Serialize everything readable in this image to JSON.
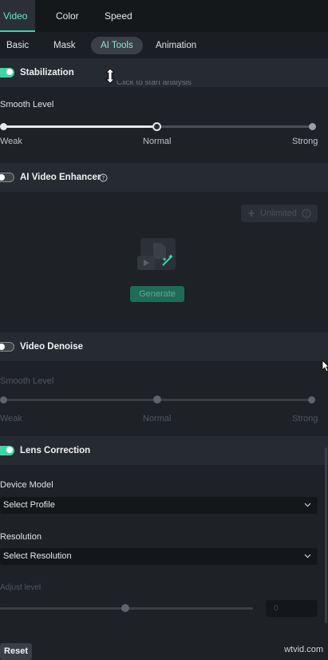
{
  "top_tabs": [
    {
      "label": "Video",
      "active": true
    },
    {
      "label": "Color",
      "active": false
    },
    {
      "label": "Speed",
      "active": false
    }
  ],
  "sub_tabs": [
    {
      "label": "Basic",
      "active": false
    },
    {
      "label": "Mask",
      "active": false
    },
    {
      "label": "AI Tools",
      "active": true
    },
    {
      "label": "Animation",
      "active": false
    }
  ],
  "stabilization": {
    "title": "Stabilization",
    "enabled": true,
    "overlap_text": "Click to start analysis",
    "smooth_label": "Smooth Level",
    "levels": [
      "Weak",
      "Normal",
      "Strong"
    ],
    "value_fraction": 0.5
  },
  "enhancer": {
    "title": "AI Video Enhancer",
    "enabled": false,
    "badge": "Unlimited",
    "generate_label": "Generate"
  },
  "denoise": {
    "title": "Video Denoise",
    "enabled": false,
    "smooth_label": "Smooth Level",
    "levels": [
      "Weak",
      "Normal",
      "Strong"
    ],
    "value_fraction": 0.5
  },
  "lens": {
    "title": "Lens Correction",
    "enabled": true,
    "device_label": "Device Model",
    "device_value": "Select Profile",
    "resolution_label": "Resolution",
    "resolution_value": "Select Resolution",
    "adjust_label": "Adjust level",
    "adjust_value": "0"
  },
  "footer": {
    "reset_label": "Reset",
    "watermark": "wtvid.com"
  },
  "colors": {
    "accent": "#3fd3a6",
    "panel": "#1e2227",
    "header": "#262b31"
  },
  "icons": {
    "resize_cursor": "vertical-resize-icon",
    "help": "help-circle-icon",
    "plus": "plus-icon",
    "chevron": "chevron-down-icon",
    "mouse": "mouse-cursor-icon"
  }
}
